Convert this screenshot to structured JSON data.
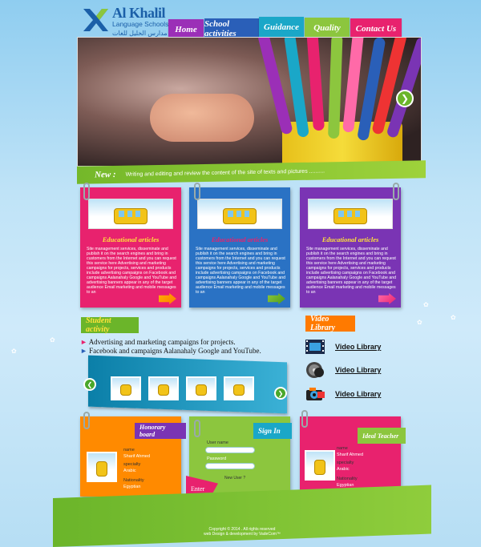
{
  "logo": {
    "name": "Al Khalil",
    "subtitle": "Language Schools",
    "arabic": "مدارس الخليل للغات"
  },
  "nav": [
    {
      "label": "Home",
      "color": "#9b2fb7"
    },
    {
      "label": "School activities",
      "color": "#2a5fb8"
    },
    {
      "label": "Guidance",
      "color": "#1aa7c8"
    },
    {
      "label": "Quality",
      "color": "#8cc63e"
    },
    {
      "label": "Contact Us",
      "color": "#e8226e"
    }
  ],
  "news": {
    "label": "New :",
    "text": "Writing and editing and review the content of the site of texts and pictures .........."
  },
  "articles": [
    {
      "title": "Educational articles",
      "color": "#e8226e",
      "title_color": "#ffe23a",
      "body": "Site management services, disseminate and publish it on the search engines and bring in customers from the Internet and you can request this service here Advertising and marketing campaigns for projects, services and products include advertising campaigns on Facebook and campaigns Aalanahaly Google and YouTube and advertising banners appear in any of the target audience Email marketing and mobile messages to an"
    },
    {
      "title": "Educational articles",
      "color": "#2a72c4",
      "title_color": "#e8226e",
      "body": "Site management services, disseminate and publish it on the search engines and bring in customers from the Internet and you can request this service here Advertising and marketing campaigns for projects, services and products include advertising campaigns on Facebook and campaigns Aalanahaly Google and YouTube and advertising banners appear in any of the target audience Email marketing and mobile messages to an"
    },
    {
      "title": "Educational articles",
      "color": "#7a34b4",
      "title_color": "#ffe23a",
      "body": "Site management services, disseminate and publish it on the search engines and bring in customers from the Internet and you can request this service here Advertising and marketing campaigns for projects, services and products include advertising campaigns on Facebook and campaigns Aalanahaly Google and YouTube and advertising banners appear in any of the target audience Email marketing and mobile messages to an"
    }
  ],
  "student_activity": {
    "label": "Student activity",
    "items": [
      "Advertising and marketing campaigns for projects.",
      "Facebook and campaigns Aalanahaly Google and YouTube."
    ]
  },
  "video_library": {
    "label": "Video Library",
    "items": [
      {
        "label": "Video Library",
        "icon": "film-icon"
      },
      {
        "label": "Video Library",
        "icon": "disc-icon"
      },
      {
        "label": "Video Library",
        "icon": "camera-icon"
      }
    ]
  },
  "honorary": {
    "label": "Honorary board",
    "name_key": "name",
    "name": "Sharif Ahmed",
    "spec_key": "specialty",
    "spec": "Arabic",
    "nat_key": "Nationality",
    "nat": "Egyptian"
  },
  "signin": {
    "label": "Sign In",
    "user_label": "User name",
    "pass_label": "Password",
    "new_user": "New User ?",
    "enter": "Enter"
  },
  "ideal_teacher": {
    "label": "Ideal Teacher",
    "name_key": "name",
    "name": "Sharif Ahmed",
    "spec_key": "specialty",
    "spec": "Arabic",
    "nat_key": "Nationality",
    "nat": "Egyptian"
  },
  "footer": {
    "line1": "Copyright © 2014 . All rights reserved",
    "line2": "web Design & development by VadeCom™"
  }
}
